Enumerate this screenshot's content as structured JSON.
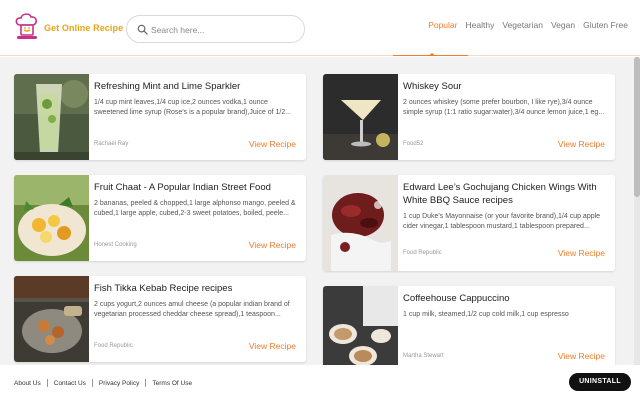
{
  "brand": {
    "name": "Get Online Recipe",
    "accent": "#f07d2c",
    "logo_color": "#e8a317"
  },
  "search": {
    "placeholder": "Search here..."
  },
  "nav": {
    "items": [
      {
        "label": "Popular",
        "active": true
      },
      {
        "label": "Healthy",
        "active": false
      },
      {
        "label": "Vegetarian",
        "active": false
      },
      {
        "label": "Vegan",
        "active": false
      },
      {
        "label": "Gluten Free",
        "active": false
      }
    ]
  },
  "recipes": [
    {
      "title": "Refreshing Mint and Lime Sparkler",
      "description": "1/4 cup mint leaves,1/4 cup ice,2 ounces vodka,1 ounce sweetened lime syrup (Rose's is a popular brand),Juice of 1/2...",
      "source": "Rachael Ray",
      "link": "View Recipe",
      "image": "mint-lime-drink-photo"
    },
    {
      "title": "Whiskey Sour",
      "description": "2 ounces whiskey (some prefer bourbon, I like rye),3/4 ounce simple syrup (1:1 ratio sugar:water),3/4 ounce lemon juice,1 eg...",
      "source": "Food52",
      "link": "View Recipe",
      "image": "whiskey-sour-photo"
    },
    {
      "title": "Fruit Chaat - A Popular Indian Street Food",
      "description": "2 bananas, peeled & chopped,1 large alphonso mango, peeled & cubed,1 large apple, cubed,2-3 sweet potatoes, boiled, peele...",
      "source": "Honest Cooking",
      "link": "View Recipe",
      "image": "fruit-chaat-photo"
    },
    {
      "title": "Edward Lee’s Gochujang Chicken Wings With White BBQ Sauce recipes",
      "description": "1 cup Duke's Mayonnaise (or your favorite brand),1/4 cup apple cider vinegar,1 tablespoon mustard,1 tablespoon prepared...",
      "source": "Food Republic",
      "link": "View Recipe",
      "image": "chicken-wings-photo"
    },
    {
      "title": "Fish Tikka Kebab Recipe recipes",
      "description": "2 cups yogurt,2 ounces amul cheese (a popular indian brand of vegetarian processed cheddar cheese spread),1 teaspoon...",
      "source": "Food Republic",
      "link": "View Recipe",
      "image": "fish-tikka-photo"
    },
    {
      "title": "Coffeehouse Cappuccino",
      "description": "1 cup milk, steamed,1/2 cup cold milk,1 cup espresso",
      "source": "Martha Stewart",
      "link": "View Recipe",
      "image": "cappuccino-photo"
    }
  ],
  "footer": {
    "links": [
      "About Us",
      "Contact Us",
      "Privacy Policy",
      "Terms Of Use"
    ],
    "uninstall": "UNINSTALL"
  }
}
